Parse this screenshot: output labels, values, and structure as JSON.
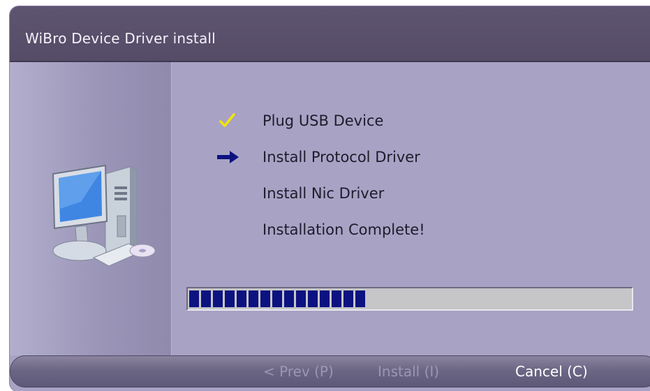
{
  "window": {
    "title": "WiBro Device Driver install"
  },
  "steps": [
    {
      "label": "Plug USB Device",
      "status": "done",
      "icon": "check-icon"
    },
    {
      "label": "Install Protocol Driver",
      "status": "current",
      "icon": "arrow-right-icon"
    },
    {
      "label": "Install Nic Driver",
      "status": "pending",
      "icon": ""
    },
    {
      "label": "Installation Complete!",
      "status": "pending",
      "icon": ""
    }
  ],
  "progress": {
    "fraction": 0.41,
    "color": "#0c1280"
  },
  "buttons": {
    "prev_label": "< Prev (P)",
    "install_label": "Install (I)",
    "cancel_label": "Cancel (C)"
  },
  "colors": {
    "check": "#f2e400",
    "arrow": "#0c1280",
    "disabled_text": "#9c97b4"
  }
}
